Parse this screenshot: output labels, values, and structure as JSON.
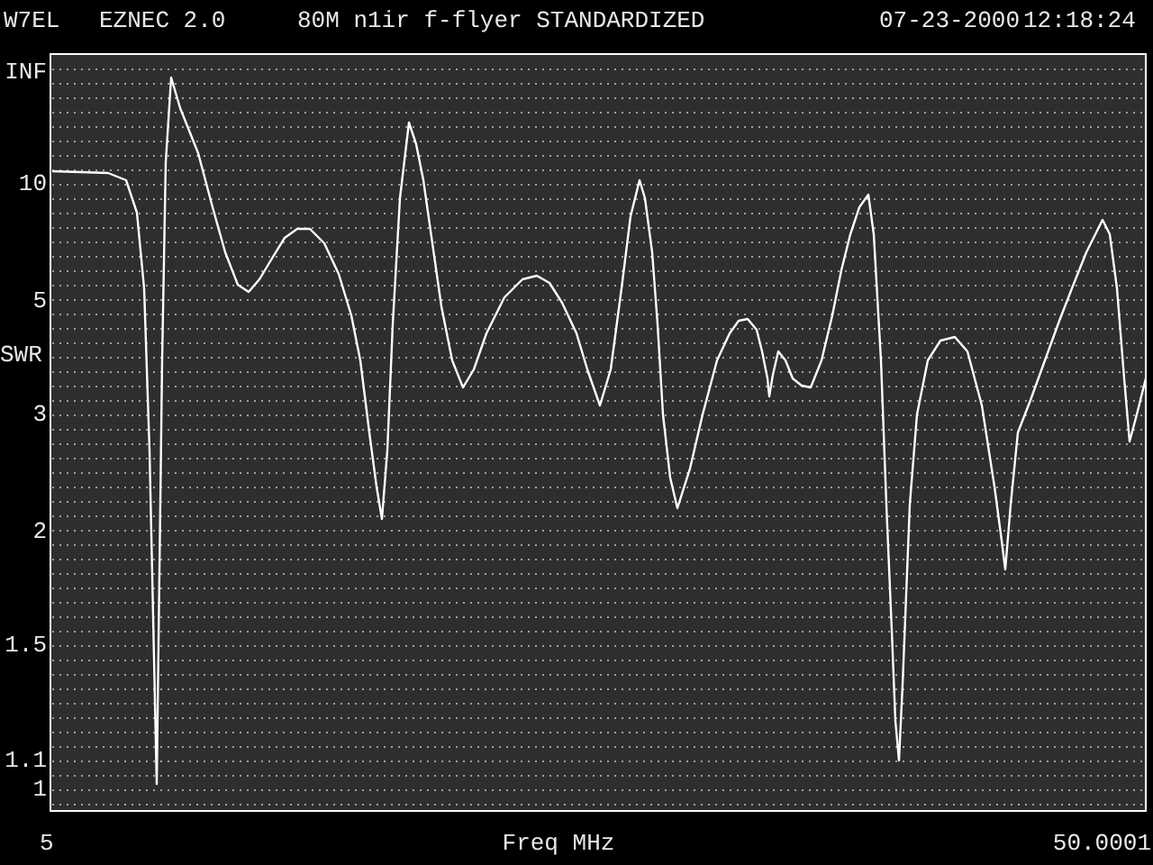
{
  "header": {
    "callsign": "W7EL",
    "program": "EZNEC 2.0",
    "title": "80M n1ir f-flyer STANDARDIZED",
    "date": "07-23-2000",
    "time": "12:18:24"
  },
  "plot": {
    "y_axis": {
      "label": "SWR",
      "ticks": [
        "INF",
        "10",
        "5",
        "3",
        "2",
        "1.5",
        "1.1",
        "1"
      ]
    },
    "x_axis": {
      "label": "Freq MHz",
      "start": "5",
      "end": "50.0001"
    }
  }
}
